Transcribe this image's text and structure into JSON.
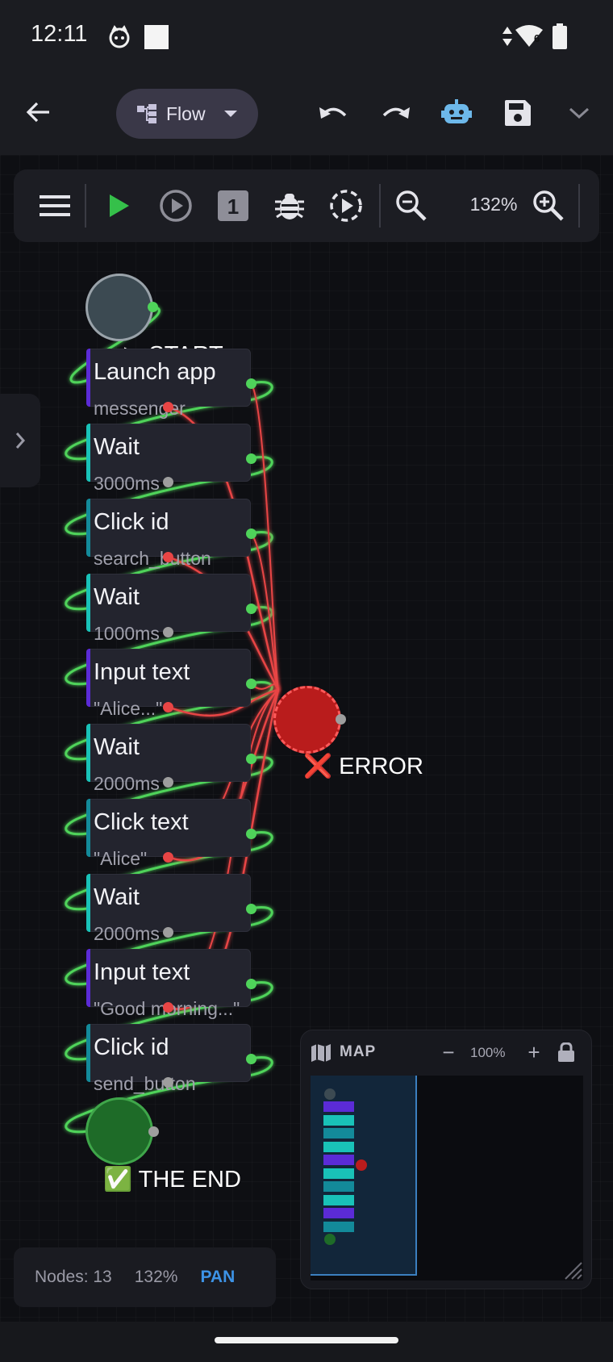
{
  "status_bar": {
    "time": "12:11",
    "network_badge": "6",
    "icons": [
      "cat-face-icon",
      "square-notification-icon",
      "data-arrows-icon",
      "wifi-icon",
      "battery-icon"
    ]
  },
  "app_bar": {
    "mode_label": "Flow",
    "icons": [
      "back-arrow-icon",
      "flow-mode-icon",
      "undo-icon",
      "redo-icon",
      "robot-icon",
      "save-icon",
      "chevron-down-icon"
    ],
    "robot_color": "#6db8ea"
  },
  "toolbar": {
    "zoom_level": "132%",
    "step_badge": "1",
    "icons": [
      "menu-icon",
      "play-icon",
      "play-circle-icon",
      "step-one-icon",
      "bug-icon",
      "dashed-play-icon",
      "zoom-out-icon",
      "zoom-in-icon"
    ],
    "play_color": "#35c04a"
  },
  "flow": {
    "start_label": "▶ START",
    "error_label": "❌ ERROR",
    "end_label": "✅ THE END",
    "nodes": [
      {
        "title": "Launch app",
        "subtitle": "messenger",
        "accent": "#5b2bd6"
      },
      {
        "title": "Wait",
        "subtitle": "3000ms",
        "accent": "#19c2b8"
      },
      {
        "title": "Click id",
        "subtitle": "search_button",
        "accent": "#138a9a"
      },
      {
        "title": "Wait",
        "subtitle": "1000ms",
        "accent": "#19c2b8"
      },
      {
        "title": "Input text",
        "subtitle": "\"Alice...\"",
        "accent": "#5b2bd6"
      },
      {
        "title": "Wait",
        "subtitle": "2000ms",
        "accent": "#19c2b8"
      },
      {
        "title": "Click text",
        "subtitle": "\"Alice\"",
        "accent": "#138a9a"
      },
      {
        "title": "Wait",
        "subtitle": "2000ms",
        "accent": "#19c2b8"
      },
      {
        "title": "Input text",
        "subtitle": "\"Good morning...\"",
        "accent": "#5b2bd6"
      },
      {
        "title": "Click id",
        "subtitle": "send_button",
        "accent": "#138a9a"
      }
    ],
    "colors": {
      "success_wire": "#4fd35a",
      "error_wire": "#e84545",
      "error_node": "#b91c1c",
      "end_node": "#1e6b28",
      "start_node": "#3c4a52"
    }
  },
  "stats": {
    "nodes_text": "Nodes: 13",
    "zoom_text": "132%",
    "mode_text": "PAN"
  },
  "minimap": {
    "title": "MAP",
    "zoom_text": "100%",
    "minus": "−",
    "plus": "+",
    "icons": [
      "map-icon",
      "lock-icon"
    ]
  }
}
